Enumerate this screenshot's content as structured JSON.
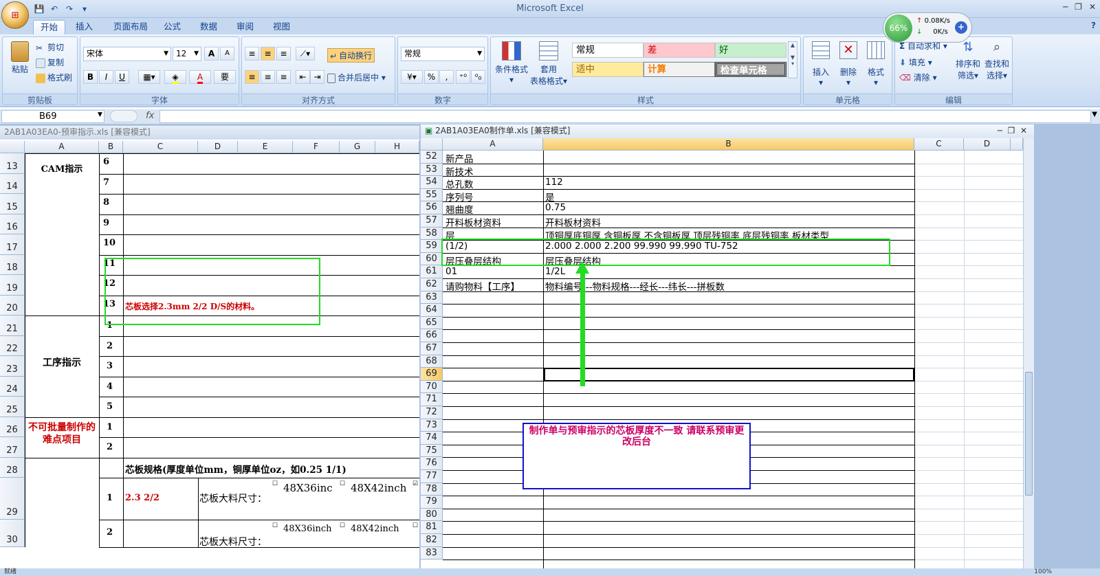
{
  "app": {
    "title": "Microsoft Excel",
    "office_btn": "⊞"
  },
  "qat": {
    "save_icon": "save-icon",
    "undo_icon": "undo-icon",
    "redo_icon": "redo-icon"
  },
  "tabs": [
    "开始",
    "插入",
    "页面布局",
    "公式",
    "数据",
    "审阅",
    "视图"
  ],
  "ribbon": {
    "clipboard": {
      "paste": "粘贴",
      "cut": "剪切",
      "copy": "复制",
      "format_painter": "格式刷",
      "label": "剪贴板"
    },
    "font": {
      "name": "宋体",
      "size": "12",
      "label": "字体",
      "bold": "B",
      "italic": "I",
      "underline": "U",
      "grow": "A",
      "shrink": "A",
      "phonetic": "要"
    },
    "align": {
      "wrap": "自动换行",
      "merge": "合并后居中",
      "label": "对齐方式"
    },
    "number": {
      "format": "常规",
      "percent": "%",
      "comma": ",",
      "label": "数字"
    },
    "styles": {
      "cond": "条件格式",
      "table1": "套用",
      "table2": "表格格式",
      "label": "样式",
      "cells": {
        "normal": "常规",
        "bad": "差",
        "good": "好",
        "neutral": "适中",
        "calc": "计算",
        "check": "检查单元格"
      }
    },
    "cells_grp": {
      "insert": "插入",
      "delete": "删除",
      "format": "格式",
      "label": "单元格"
    },
    "editing": {
      "autosum": "自动求和",
      "fill": "填充",
      "clear": "清除",
      "sort1": "排序和",
      "sort2": "筛选",
      "find1": "查找和",
      "find2": "选择",
      "label": "编辑"
    }
  },
  "net_widget": {
    "percent": "66%",
    "up": "0.08K/s",
    "down": "0K/s"
  },
  "formula_bar": {
    "name_box": "B69",
    "fx": "fx"
  },
  "left_window": {
    "title": "2AB1A03EA0-预审指示.xls  [兼容模式]",
    "columns": [
      "A",
      "B",
      "C",
      "D",
      "E",
      "F",
      "G",
      "H"
    ],
    "rows": [
      "13",
      "14",
      "15",
      "16",
      "17",
      "18",
      "19",
      "20",
      "21",
      "22",
      "23",
      "24",
      "25",
      "26",
      "27",
      "28",
      "29",
      "30"
    ],
    "cam_label": "CAM指示",
    "cam_nums": [
      "6",
      "7",
      "8",
      "9",
      "10",
      "11",
      "12",
      "13"
    ],
    "cam_note": "芯板选择2.3mm 2/2 D/S的材料。",
    "proc_label": "工序指示",
    "proc_nums": [
      "1",
      "2",
      "3",
      "4",
      "5"
    ],
    "hard_label": "不可批量制作的难点项目",
    "hard_nums": [
      "1",
      "2"
    ],
    "spec_header": "芯板规格(厚度单位mm，铜厚单位oz，如0.25 1/1)",
    "spec_rows": [
      {
        "num": "1",
        "value": "2.3 2/2",
        "label": "芯板大料尺寸：",
        "opt1": "48X36inc",
        "opt2": "48X42inch"
      },
      {
        "num": "2",
        "value": "",
        "label": "芯板大料尺寸：",
        "opt1": "48X36inch",
        "opt2": "48X42inch"
      }
    ]
  },
  "right_window": {
    "title": "2AB1A03EA0制作单.xls  [兼容模式]",
    "columns": [
      "A",
      "B",
      "C",
      "D"
    ],
    "rows": [
      {
        "n": "52",
        "a": "新产品",
        "b": ""
      },
      {
        "n": "53",
        "a": "新技术",
        "b": ""
      },
      {
        "n": "54",
        "a": "总孔数",
        "b": "112"
      },
      {
        "n": "55",
        "a": "序列号",
        "b": "是"
      },
      {
        "n": "56",
        "a": "翘曲度",
        "b": "0.75"
      },
      {
        "n": "57",
        "a": "开料板材资料",
        "b": "开料板材资料"
      },
      {
        "n": "58",
        "a": "层",
        "b": "顶铜厚底铜厚  含铜板厚  不含铜板厚  顶层残铜率  底层残铜率  板材类型"
      },
      {
        "n": "59",
        "a": "(1/2)",
        "b": "2.000   2.000    2.200                      99.990     99.990       TU-752"
      },
      {
        "n": "60",
        "a": "层压叠层结构",
        "b": "层压叠层结构"
      },
      {
        "n": "61",
        "a": "01",
        "b": "1/2L"
      },
      {
        "n": "62",
        "a": "请购物料【工序】",
        "b": "物料编号---物料规格---经长---纬长---拼板数"
      },
      {
        "n": "63",
        "a": "",
        "b": ""
      },
      {
        "n": "64",
        "a": "",
        "b": ""
      },
      {
        "n": "65",
        "a": "",
        "b": ""
      },
      {
        "n": "66",
        "a": "",
        "b": ""
      },
      {
        "n": "67",
        "a": "",
        "b": ""
      },
      {
        "n": "68",
        "a": "",
        "b": ""
      },
      {
        "n": "69",
        "a": "",
        "b": ""
      },
      {
        "n": "70",
        "a": "",
        "b": ""
      },
      {
        "n": "71",
        "a": "",
        "b": ""
      },
      {
        "n": "72",
        "a": "",
        "b": ""
      },
      {
        "n": "73",
        "a": "",
        "b": ""
      },
      {
        "n": "74",
        "a": "",
        "b": ""
      },
      {
        "n": "75",
        "a": "",
        "b": ""
      },
      {
        "n": "76",
        "a": "",
        "b": ""
      },
      {
        "n": "77",
        "a": "",
        "b": ""
      },
      {
        "n": "78",
        "a": "",
        "b": ""
      },
      {
        "n": "79",
        "a": "",
        "b": ""
      },
      {
        "n": "80",
        "a": "",
        "b": ""
      },
      {
        "n": "81",
        "a": "",
        "b": ""
      },
      {
        "n": "82",
        "a": "",
        "b": ""
      },
      {
        "n": "83",
        "a": "",
        "b": ""
      }
    ]
  },
  "annotation": {
    "text": "制作单与预审指示的芯板厚度不一致   请联系预审更改后台"
  },
  "status": {
    "text": "就绪",
    "zoom": "100%"
  },
  "colors": {
    "green": "#22dd22",
    "red": "#cc0000",
    "blue_box": "#1111cc",
    "annotation_text": "#cc0066"
  }
}
